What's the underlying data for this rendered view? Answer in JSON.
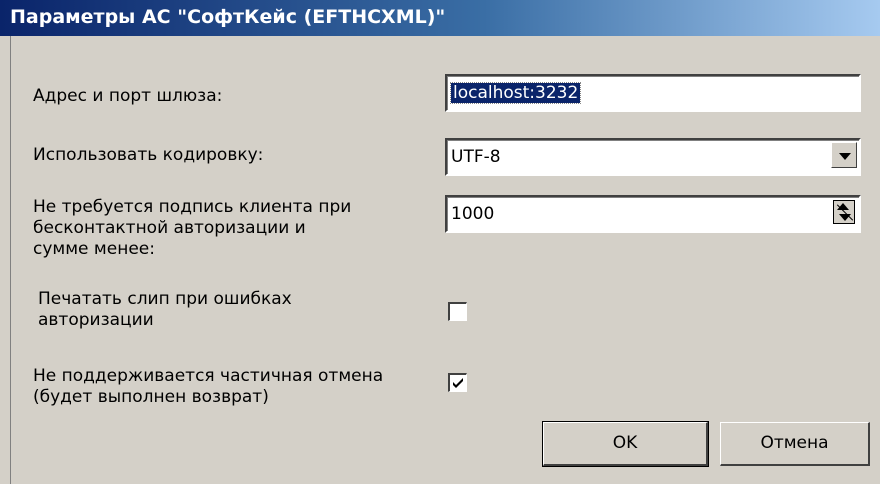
{
  "window": {
    "title": "Параметры АС \"СофтКейс (EFTHCXML)\""
  },
  "fields": {
    "gateway": {
      "label": "Адрес и порт шлюза:",
      "value": "localhost:3232"
    },
    "encoding": {
      "label": "Использовать кодировку:",
      "value": "UTF-8"
    },
    "limit": {
      "label": "Не требуется подпись клиента при\nбесконтактной авторизации и\nсумме менее:",
      "value": "1000"
    },
    "print_slip": {
      "label": "Печатать слип при ошибках\nавторизации",
      "checked": false
    },
    "partial_cancel": {
      "label": "Не поддерживается частичная отмена\n(будет выполнен возврат)",
      "checked": true
    }
  },
  "buttons": {
    "ok": "OK",
    "cancel": "Отмена"
  },
  "colors": {
    "title_start": "#0a246a",
    "title_end": "#a6caf0",
    "face": "#d4d0c8",
    "selection": "#0a246a"
  }
}
